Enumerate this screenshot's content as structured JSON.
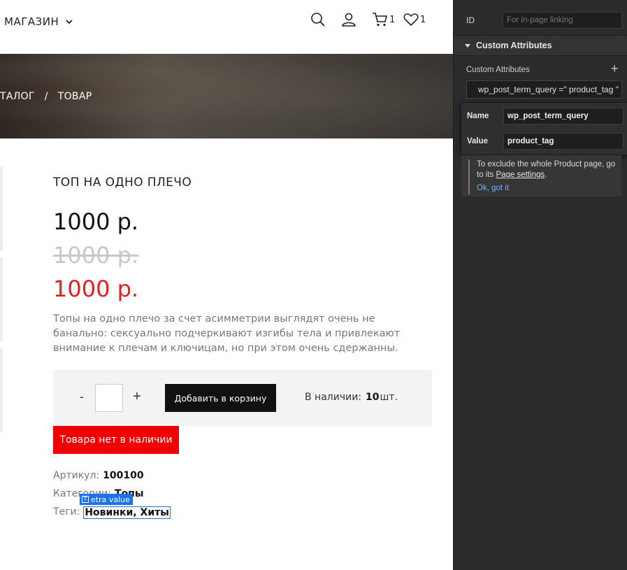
{
  "header": {
    "shop_label": "МАГАЗИН",
    "cart_count": "1",
    "wishlist_count": "1"
  },
  "breadcrumb": {
    "catalog": "ТАЛОГ",
    "separator": "/",
    "current": "ТОВАР"
  },
  "product": {
    "title": "ТОП НА ОДНО ПЛЕЧО",
    "price": "1000 р.",
    "old_price": "1000 р.",
    "sale_price": "1000 р.",
    "description": "Топы на одно плечо за счет асимметрии выглядят очень не банально: сексуально подчеркивают изгибы тела и привлекают внимание к плечам и ключицам, но при этом очень сдержанны.",
    "qty_minus": "-",
    "qty_plus": "+",
    "qty_value": "",
    "add_to_cart": "Добавить в корзину",
    "stock_label": "В наличии:",
    "stock_count": "10",
    "stock_unit": "шт.",
    "out_of_stock": "Товара нет в наличии",
    "sku_label": "Артикул:",
    "sku_value": "100100",
    "category_label": "Категории:",
    "category_value": "Топы",
    "tags_label": "Теги:",
    "tags_value": "Новинки, Хиты",
    "selection_badge": "etra value"
  },
  "panel": {
    "id_label": "ID",
    "id_placeholder": "For in-page linking",
    "section_title": "Custom Attributes",
    "attributes_label": "Custom Attributes",
    "add_button": "+",
    "attribute_chip": "wp_post_term_query =\" product_tag \"",
    "name_label": "Name",
    "name_value": "wp_post_term_query",
    "value_label": "Value",
    "value_value": "product_tag",
    "note_text_1": "To exclude the whole Product page, go to its",
    "note_link": "Page settings",
    "note_text_2": ".",
    "note_ok": "Ok, got it"
  },
  "colors": {
    "sale_red": "#e0201f",
    "oos_red": "#f00000",
    "selection_blue": "#1a73e8",
    "panel_bg": "#2b2b2b",
    "link_blue": "#6fb2ff"
  },
  "icons": [
    "chevron-down-icon",
    "search-icon",
    "user-icon",
    "cart-icon",
    "heart-icon",
    "text-element-icon",
    "triangle-down-icon",
    "plus-icon"
  ]
}
